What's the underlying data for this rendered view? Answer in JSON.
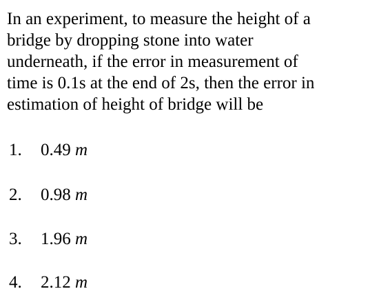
{
  "question": {
    "lines": [
      "In an experiment, to measure the height of a",
      "bridge by dropping stone into water",
      "underneath, if the error in measurement of",
      "time is 0.1s at the end of 2s, then the error in",
      "estimation of height of  bridge will be"
    ]
  },
  "options": [
    {
      "number": "1.",
      "value": "0.49",
      "unit": "m"
    },
    {
      "number": "2.",
      "value": "0.98",
      "unit": "m"
    },
    {
      "number": "3.",
      "value": "1.96",
      "unit": "m"
    },
    {
      "number": "4.",
      "value": "2.12",
      "unit": "m"
    }
  ]
}
